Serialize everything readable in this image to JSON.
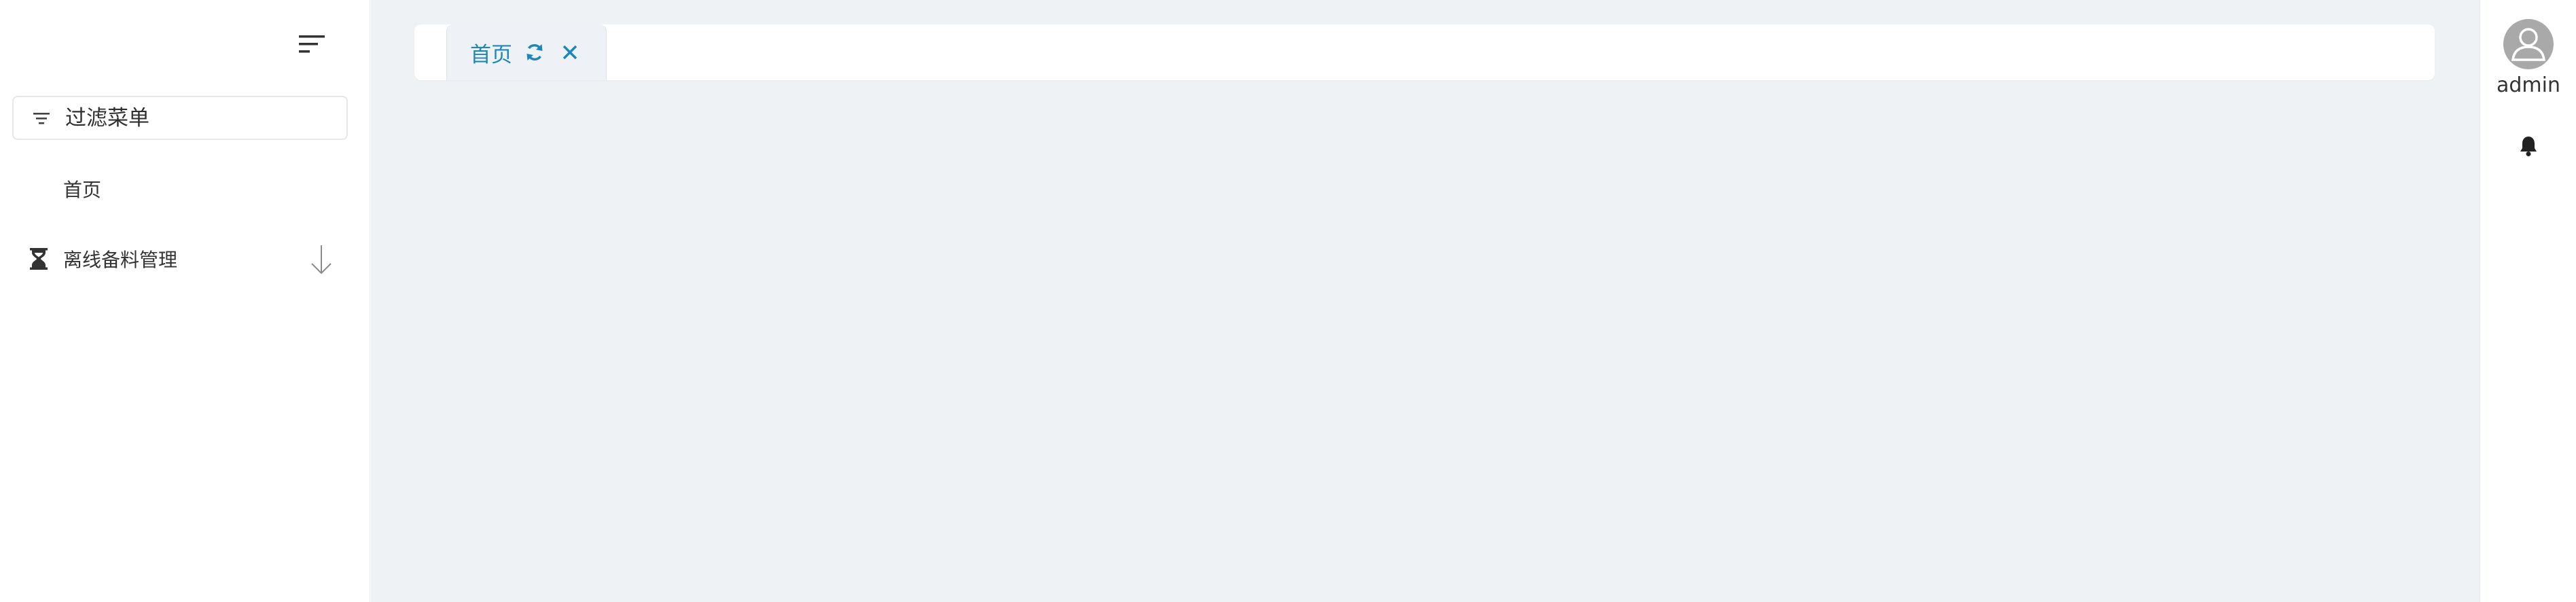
{
  "sidebar": {
    "filter": {
      "placeholder": "过滤菜单",
      "value": ""
    },
    "menu": [
      {
        "label": "首页",
        "icon": ""
      },
      {
        "label": "离线备料管理",
        "icon": "hourglass-icon",
        "expand_icon": "arrow-down-icon"
      }
    ]
  },
  "tabs": [
    {
      "label": "首页",
      "active": true
    }
  ],
  "user": {
    "name": "admin"
  },
  "colors": {
    "accent": "#1f87b8",
    "main_bg": "#eff2f5",
    "sidebar_bg": "#ffffff",
    "avatar_bg": "#a9a9a9"
  }
}
